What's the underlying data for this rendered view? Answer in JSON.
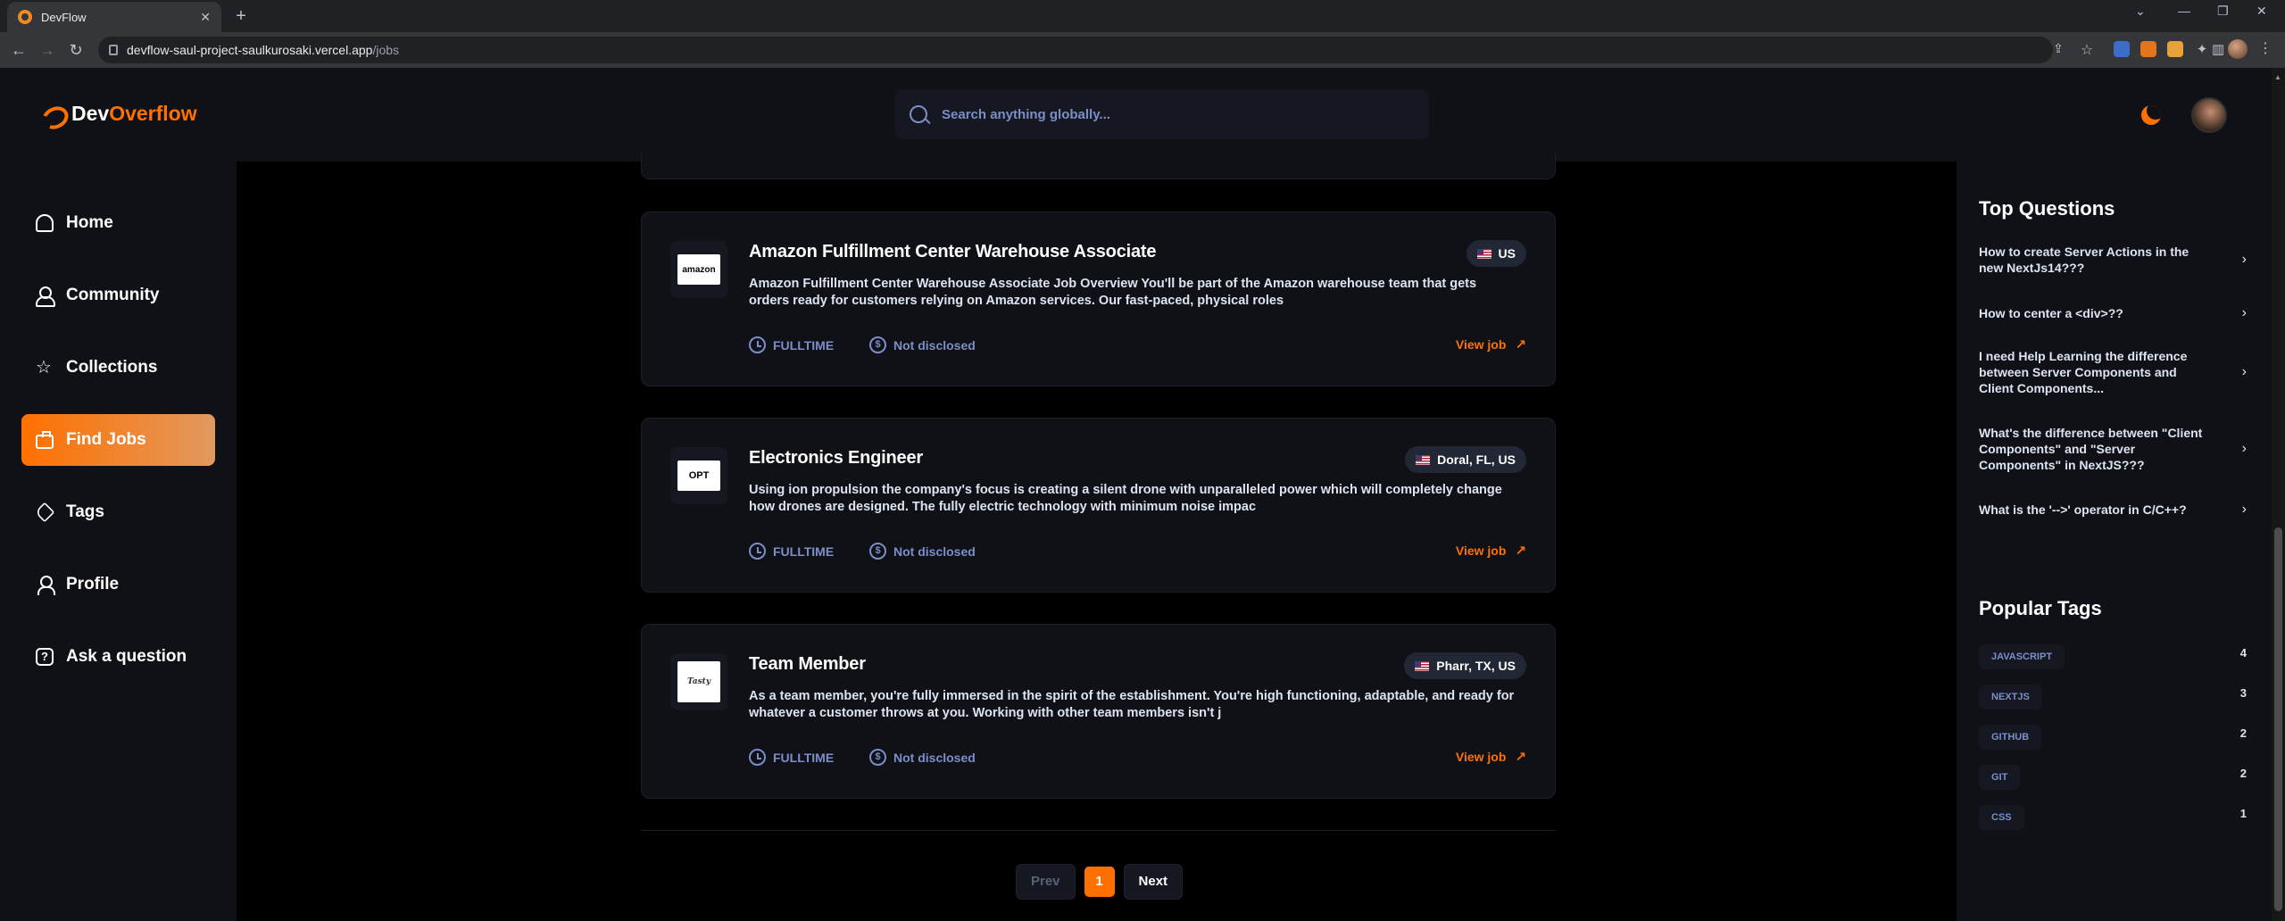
{
  "browser": {
    "tab_title": "DevFlow",
    "url_host": "devflow-saul-project-saulkurosaki.vercel.app",
    "url_path": "/jobs"
  },
  "header": {
    "logo_dev": "Dev",
    "logo_overflow": "Overflow",
    "search_placeholder": "Search anything globally..."
  },
  "sidebar": {
    "items": [
      {
        "label": "Home",
        "icon": "home-icon"
      },
      {
        "label": "Community",
        "icon": "users-icon"
      },
      {
        "label": "Collections",
        "icon": "star-icon"
      },
      {
        "label": "Find Jobs",
        "icon": "briefcase-icon",
        "active": true
      },
      {
        "label": "Tags",
        "icon": "tag-icon"
      },
      {
        "label": "Profile",
        "icon": "user-icon"
      },
      {
        "label": "Ask a question",
        "icon": "question-icon"
      }
    ]
  },
  "jobs": [
    {
      "title": "Amazon Fulfillment Center Warehouse Associate",
      "description": "Amazon Fulfillment Center Warehouse Associate Job Overview You'll be part of the Amazon warehouse team that gets orders ready for customers relying on Amazon services. Our fast-paced, physical roles",
      "location": "US",
      "employment_type": "FULLTIME",
      "salary": "Not disclosed",
      "action": "View job",
      "logo_text": "amazon"
    },
    {
      "title": "Electronics Engineer",
      "description": "Using ion propulsion the company's focus is creating a silent drone with unparalleled power which will completely change how drones are designed. The fully electric technology with minimum noise impac",
      "location": "Doral, FL, US",
      "employment_type": "FULLTIME",
      "salary": "Not disclosed",
      "action": "View job",
      "logo_text": "OPT"
    },
    {
      "title": "Team Member",
      "description": "As a team member, you're fully immersed in the spirit of the establishment. You're high functioning, adaptable, and ready for whatever a customer throws at you. Working with other team members isn't j",
      "location": "Pharr, TX, US",
      "employment_type": "FULLTIME",
      "salary": "Not disclosed",
      "action": "View job",
      "logo_text": "Tasty"
    }
  ],
  "pagination": {
    "prev": "Prev",
    "current": "1",
    "next": "Next"
  },
  "right_sidebar": {
    "top_questions_heading": "Top Questions",
    "questions": [
      "How to create Server Actions in the new NextJs14???",
      "How to center a <div>??",
      "I need Help Learning the difference between Server Components and Client Components...",
      "What's the difference between \"Client Components\" and \"Server Components\" in NextJS???",
      "What is the '-->' operator in C/C++?"
    ],
    "popular_tags_heading": "Popular Tags",
    "tags": [
      {
        "name": "JAVASCRIPT",
        "count": "4"
      },
      {
        "name": "NEXTJS",
        "count": "3"
      },
      {
        "name": "GITHUB",
        "count": "2"
      },
      {
        "name": "GIT",
        "count": "2"
      },
      {
        "name": "CSS",
        "count": "1"
      }
    ]
  },
  "colors": {
    "accent": "#ff7000",
    "background": "#000000",
    "panel": "#0f1117",
    "muted_text": "#7b8ec8"
  }
}
